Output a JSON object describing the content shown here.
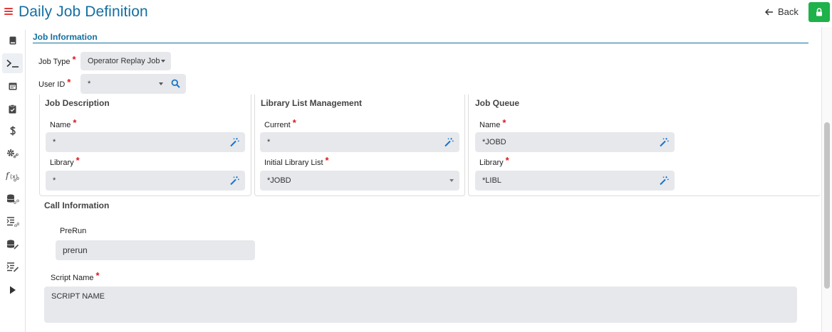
{
  "header": {
    "title": "Daily Job Definition",
    "back_label": "Back"
  },
  "colors": {
    "title": "#136fa1",
    "required": "#e0161c",
    "lock_button": "#1fb14a",
    "field_bg": "#e6e8ec"
  },
  "sidebar": {
    "items": [
      {
        "icon": "book-icon"
      },
      {
        "icon": "terminal-icon"
      },
      {
        "icon": "calendar-icon"
      },
      {
        "icon": "clipboard-check-icon"
      },
      {
        "icon": "dollar-icon"
      },
      {
        "icon": "gear-link-icon"
      },
      {
        "icon": "function-link-icon"
      },
      {
        "icon": "database-link-icon"
      },
      {
        "icon": "list-link-icon"
      },
      {
        "icon": "database-edit-icon"
      },
      {
        "icon": "list-edit-icon"
      },
      {
        "icon": "play-icon"
      }
    ]
  },
  "job_information": {
    "section_title": "Job Information",
    "job_type": {
      "label": "Job Type",
      "value": "Operator Replay Job"
    },
    "user_id": {
      "label": "User ID",
      "value": "*"
    }
  },
  "job_description": {
    "title": "Job Description",
    "name": {
      "label": "Name",
      "value": "*"
    },
    "library": {
      "label": "Library",
      "value": "*"
    }
  },
  "library_list": {
    "title": "Library List Management",
    "current": {
      "label": "Current",
      "value": "*"
    },
    "initial": {
      "label": "Initial Library List",
      "value": "*JOBD"
    }
  },
  "job_queue": {
    "title": "Job Queue",
    "name": {
      "label": "Name",
      "value": "*JOBD"
    },
    "library": {
      "label": "Library",
      "value": "*LIBL"
    }
  },
  "call_information": {
    "title": "Call Information",
    "prerun": {
      "label": "PreRun",
      "value": "prerun"
    },
    "script_name": {
      "label": "Script Name",
      "value": "SCRIPT NAME"
    }
  }
}
